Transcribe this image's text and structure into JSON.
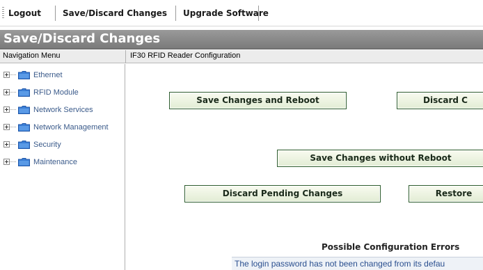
{
  "toolbar": {
    "logout": "Logout",
    "save_discard": "Save/Discard Changes",
    "upgrade": "Upgrade Software"
  },
  "page": {
    "title": "Save/Discard Changes"
  },
  "nav": {
    "header": "Navigation Menu",
    "items": [
      {
        "label": "Ethernet",
        "icon": "folder-icon"
      },
      {
        "label": "RFID Module",
        "icon": "folder-icon"
      },
      {
        "label": "Network Services",
        "icon": "folder-icon"
      },
      {
        "label": "Network Management",
        "icon": "folder-icon"
      },
      {
        "label": "Security",
        "icon": "folder-icon"
      },
      {
        "label": "Maintenance",
        "icon": "folder-icon"
      }
    ]
  },
  "content": {
    "header": "IF30 RFID Reader Configuration",
    "buttons": {
      "save_reboot": "Save Changes and Reboot",
      "discard_changes": "Discard C",
      "save_no_reboot": "Save Changes without Reboot",
      "discard_pending": "Discard Pending Changes",
      "restore": "Restore"
    },
    "errors": {
      "title": "Possible Configuration Errors",
      "items": [
        "The login password has not been changed from its defau"
      ]
    }
  },
  "colors": {
    "banner": "#8a8a8a",
    "nav_text": "#3a5a8a",
    "button_border": "#2e5d2e",
    "error_text": "#2a4f8f"
  }
}
